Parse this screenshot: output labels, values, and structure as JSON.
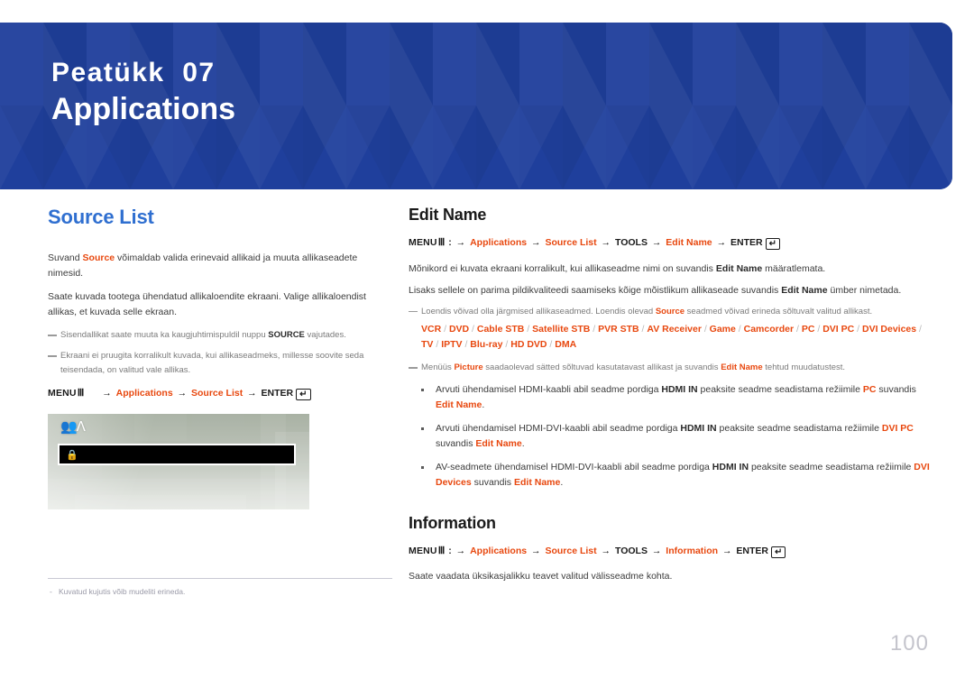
{
  "banner": {
    "chapter_label": "Peatükk  07",
    "chapter_title": "Applications",
    "color": "#1f3f9c"
  },
  "left_column": {
    "section_title": "Source List",
    "paragraphs": [
      {
        "id": "p1",
        "parts": [
          {
            "t": "Suvand ",
            "s": "n"
          },
          {
            "t": "Source",
            "s": "r"
          },
          {
            "t": " võimaldab valida erinevaid allikaid ja muuta allikaseadete nimesid.",
            "s": "n"
          }
        ]
      },
      {
        "id": "p2",
        "parts": [
          {
            "t": "Saate kuvada tootega ühendatud allikaloendite ekraani. Valige allikaloendist allikas, et kuvada selle ekraan.",
            "s": "n"
          }
        ]
      }
    ],
    "notes": [
      {
        "id": "n1",
        "parts": [
          {
            "t": "Sisendallikat saate muuta ka kaugjuhtimispuldil nuppu ",
            "s": "n"
          },
          {
            "t": "SOURCE",
            "s": "k"
          },
          {
            "t": " vajutades.",
            "s": "n"
          }
        ]
      },
      {
        "id": "n2",
        "parts": [
          {
            "t": "Ekraani ei pruugita korralikult kuvada, kui allikaseadmeks, millesse soovite seda teisendada, on valitud vale allikas.",
            "s": "n"
          }
        ]
      }
    ],
    "menu_path": {
      "menu_label": "MENU",
      "menu_glyph": "Ⅲ",
      "separator": "",
      "steps": [
        "Applications",
        "Source List"
      ],
      "steps_red": [
        true,
        true
      ],
      "enter_label": "ENTER",
      "enter_glyph": "↵",
      "arrow": "→"
    },
    "screenshot": {
      "top_icon": "source-people-icon",
      "bar_icon": "lock-icon"
    }
  },
  "right_column": {
    "edit_name": {
      "title": "Edit Name",
      "menu_path": {
        "menu_label": "MENU",
        "menu_glyph": "Ⅲ",
        "colon": ":",
        "steps": [
          "Applications",
          "Source List",
          "TOOLS",
          "Edit Name"
        ],
        "steps_red": [
          true,
          true,
          false,
          true
        ],
        "enter_label": "ENTER",
        "enter_glyph": "↵",
        "arrow": "→"
      },
      "paragraphs": [
        {
          "id": "e1",
          "parts": [
            {
              "t": "Mõnikord ei kuvata ekraani korralikult, kui allikaseadme nimi on suvandis ",
              "s": "n"
            },
            {
              "t": "Edit Name",
              "s": "k"
            },
            {
              "t": " määratlemata.",
              "s": "n"
            }
          ]
        },
        {
          "id": "e2",
          "parts": [
            {
              "t": "Lisaks sellele on parima pildikvaliteedi saamiseks kõige mõistlikum allikaseade suvandis ",
              "s": "n"
            },
            {
              "t": "Edit Name",
              "s": "k"
            },
            {
              "t": " ümber nimetada.",
              "s": "n"
            }
          ]
        }
      ],
      "note_list": {
        "parts": [
          {
            "t": "Loendis võivad olla järgmised allikaseadmed. Loendis olevad ",
            "s": "n"
          },
          {
            "t": "Source",
            "s": "r"
          },
          {
            "t": " seadmed võivad erineda sõltuvalt valitud allikast.",
            "s": "n"
          }
        ]
      },
      "devices": [
        "VCR",
        "DVD",
        "Cable STB",
        "Satellite STB",
        "PVR STB",
        "AV Receiver",
        "Game",
        "Camcorder",
        "PC",
        "DVI PC",
        "DVI Devices",
        "TV",
        "IPTV",
        "Blu-ray",
        "HD DVD",
        "DMA"
      ],
      "device_separator": "/",
      "note_picture": {
        "parts": [
          {
            "t": "Menüüs ",
            "s": "n"
          },
          {
            "t": "Picture",
            "s": "r"
          },
          {
            "t": " saadaolevad sätted sõltuvad kasutatavast allikast ja suvandis ",
            "s": "n"
          },
          {
            "t": "Edit Name",
            "s": "r"
          },
          {
            "t": " tehtud muudatustest.",
            "s": "n"
          }
        ]
      },
      "bullets": [
        {
          "id": "b1",
          "parts": [
            {
              "t": "Arvuti ühendamisel HDMI-kaabli abil seadme pordiga ",
              "s": "n"
            },
            {
              "t": "HDMI IN",
              "s": "k"
            },
            {
              "t": " peaksite seadme seadistama režiimile ",
              "s": "n"
            },
            {
              "t": "PC",
              "s": "r"
            },
            {
              "t": " suvandis ",
              "s": "n"
            },
            {
              "t": "Edit Name",
              "s": "r"
            },
            {
              "t": ".",
              "s": "n"
            }
          ]
        },
        {
          "id": "b2",
          "parts": [
            {
              "t": "Arvuti ühendamisel HDMI-DVI-kaabli abil seadme pordiga ",
              "s": "n"
            },
            {
              "t": "HDMI IN",
              "s": "k"
            },
            {
              "t": " peaksite seadme seadistama režiimile ",
              "s": "n"
            },
            {
              "t": "DVI PC",
              "s": "r"
            },
            {
              "t": " suvandis ",
              "s": "n"
            },
            {
              "t": "Edit Name",
              "s": "r"
            },
            {
              "t": ".",
              "s": "n"
            }
          ]
        },
        {
          "id": "b3",
          "parts": [
            {
              "t": "AV-seadmete ühendamisel HDMI-DVI-kaabli abil seadme pordiga ",
              "s": "n"
            },
            {
              "t": "HDMI IN",
              "s": "k"
            },
            {
              "t": " peaksite seadme seadistama režiimile ",
              "s": "n"
            },
            {
              "t": "DVI Devices",
              "s": "r"
            },
            {
              "t": " suvandis ",
              "s": "n"
            },
            {
              "t": "Edit Name",
              "s": "r"
            },
            {
              "t": ".",
              "s": "n"
            }
          ]
        }
      ]
    },
    "information": {
      "title": "Information",
      "menu_path": {
        "menu_label": "MENU",
        "menu_glyph": "Ⅲ",
        "colon": ":",
        "steps": [
          "Applications",
          "Source List",
          "TOOLS",
          "Information"
        ],
        "steps_red": [
          true,
          true,
          false,
          true
        ],
        "enter_label": "ENTER",
        "enter_glyph": "↵",
        "arrow": "→"
      },
      "paragraph": {
        "parts": [
          {
            "t": "Saate vaadata üksikasjalikku teavet valitud välisseadme kohta.",
            "s": "n"
          }
        ]
      }
    }
  },
  "footnote": "Kuvatud kujutis võib mudeliti erineda.",
  "page_number": "100",
  "colors": {
    "banner_blue": "#1f3f9c",
    "heading_blue": "#2f6fd0",
    "accent_orange": "#e8480f",
    "body_gray": "#3b3b3b",
    "note_gray": "#7b7b7b",
    "page_number_gray": "#c4c4cc"
  }
}
